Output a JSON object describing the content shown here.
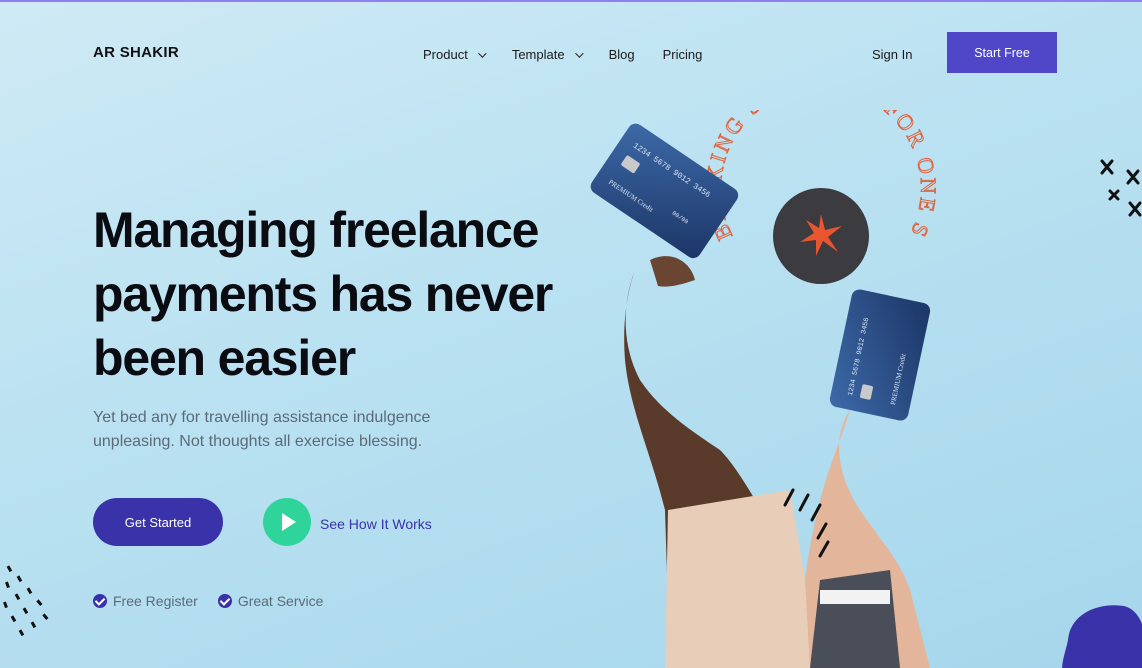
{
  "brand": {
    "logo": "AR SHAKIR"
  },
  "nav": {
    "items": [
      {
        "label": "Product",
        "dropdown": true
      },
      {
        "label": "Template",
        "dropdown": true
      },
      {
        "label": "Blog",
        "dropdown": false
      },
      {
        "label": "Pricing",
        "dropdown": false
      }
    ],
    "sign_in": "Sign In",
    "start_free": "Start Free"
  },
  "hero": {
    "headline_lines": [
      "Managing freelance",
      "payments has never",
      "been easier"
    ],
    "subtext": "Yet bed any for travelling assistance indulgence unpleasing. Not thoughts all exercise blessing.",
    "cta_primary": "Get Started",
    "cta_secondary": "See How It Works",
    "features": [
      "Free Register",
      "Great Service"
    ]
  },
  "art": {
    "badge_text": "BANKING SOLUTION FOR ONE STOP",
    "card_label": "PREMIUM Credit",
    "card_number": "1234 5678 9012 3456",
    "card_expiry": "00/00"
  },
  "colors": {
    "accent": "#3a32a8",
    "button": "#4f46c8",
    "play": "#2fd49a",
    "badge_text": "#e2643f"
  }
}
